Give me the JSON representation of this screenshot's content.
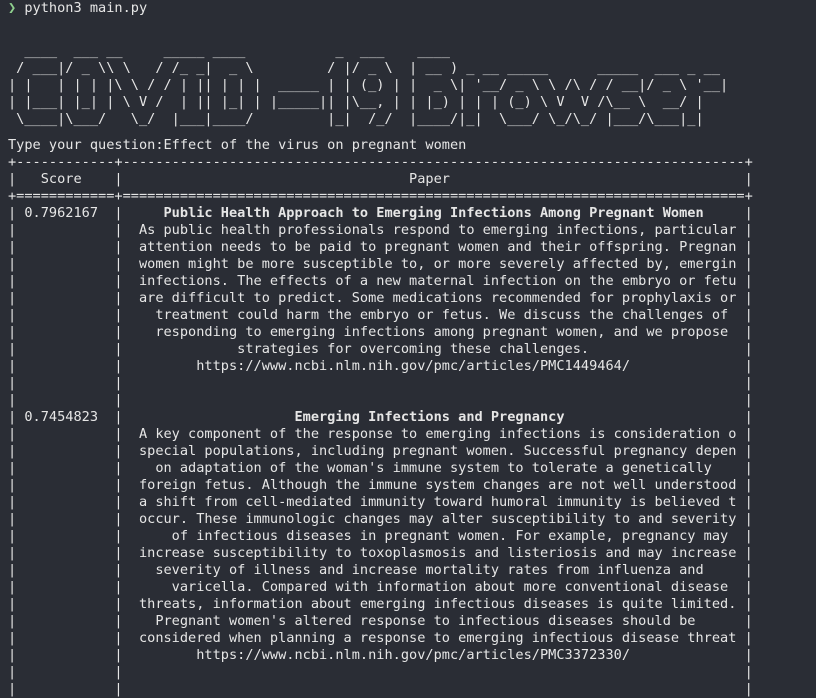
{
  "prompt": {
    "symbol": "❯",
    "command": "python3 main.py"
  },
  "banner_lines": [
    "  ____  ___ __     _____ ____           _  ___    ____",
    " / ___|/ _ \\\\ \\   / /_ _|  _ \\         / |/ _ \\  | __ ) _ __ _____      _____  ___ _ __",
    "| |   | | | |\\ \\ / / | || | | |  _____ | | (_) | |  _ \\| '__/ _ \\ \\ /\\ / / __|/ _ \\ '__|",
    "| |___| |_| | \\ V /  | || |_| | |_____|| |\\__, | | |_) | | | (_) \\ V  V /\\__ \\  __/ |",
    " \\____|\\___/   \\_/  |___|____/         |_|  /_/  |____/|_|  \\___/ \\_/\\_/ |___/\\___|_|"
  ],
  "question": {
    "label": "Type your question:",
    "value": "Effect of the virus on pregnant women"
  },
  "table": {
    "border_top": "+------------+----------------------------------------------------------------------------+",
    "header": "|   Score    |                                   Paper                                    |",
    "border_mid": "+============+============================================================================+",
    "rows": [
      {
        "score": "0.7962167",
        "title": "Public Health Approach to Emerging Infections Among Pregnant Women",
        "lines": [
          "As public health professionals respond to emerging infections, particular",
          "attention needs to be paid to pregnant women and their offspring. Pregnant",
          "women might be more susceptible to, or more severely affected by, emerging",
          "infections. The effects of a new maternal infection on the embryo or fetus",
          "are difficult to predict. Some medications recommended for prophylaxis or",
          "  treatment could harm the embryo or fetus. We discuss the challenges of",
          "  responding to emerging infections among pregnant women, and we propose",
          "            strategies for overcoming these challenges.",
          "       https://www.ncbi.nlm.nih.gov/pmc/articles/PMC1449464/"
        ]
      },
      {
        "score": "0.7454823",
        "title": "Emerging Infections and Pregnancy",
        "lines": [
          "A key component of the response to emerging infections is consideration of",
          "special populations, including pregnant women. Successful pregnancy depends",
          "  on adaptation of the woman's immune system to tolerate a genetically",
          "foreign fetus. Although the immune system changes are not well understood,",
          "a shift from cell-mediated immunity toward humoral immunity is believed to",
          "occur. These immunologic changes may alter susceptibility to and severity",
          "    of infectious diseases in pregnant women. For example, pregnancy may",
          "increase susceptibility to toxoplasmosis and listeriosis and may increase",
          "  severity of illness and increase mortality rates from influenza and",
          "    varicella. Compared with information about more conventional disease",
          "threats, information about emerging infectious diseases is quite limited.",
          "  Pregnant women's altered response to infectious diseases should be",
          "considered when planning a response to emerging infectious disease threats.",
          "       https://www.ncbi.nlm.nih.gov/pmc/articles/PMC3372330/"
        ]
      }
    ]
  }
}
